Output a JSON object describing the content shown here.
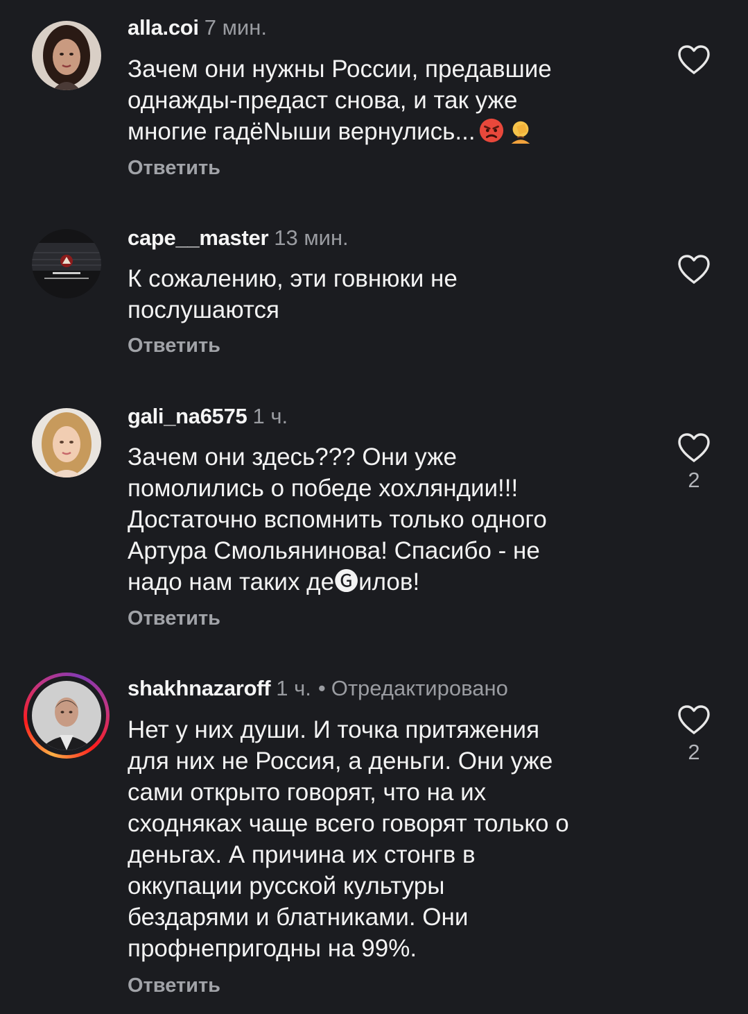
{
  "comments": [
    {
      "username": "alla.coi",
      "time": "7 мин.",
      "text": "Зачем они нужны России, предавшие\nоднажды-предаст снова, и так уже\nмногие гадёNыши вернулись...",
      "emojis": [
        "angry-face",
        "person-facepalming"
      ],
      "reply_label": "Ответить",
      "like_count": ""
    },
    {
      "username": "cape__master",
      "time": "13 мин.",
      "text": "К сожалению, эти говнюки не\nпослушаются",
      "reply_label": "Ответить",
      "like_count": ""
    },
    {
      "username": "gali_na6575",
      "time": "1 ч.",
      "text": "Зачем они здесь??? Они уже\nпомолились о победе хохляндии!!!\nДостаточно вспомнить только одного\nАртура Смольянинова! Спасибо - не\nнадо нам таких  де🅖илов!",
      "reply_label": "Ответить",
      "like_count": "2"
    },
    {
      "username": "shakhnazaroff",
      "time": "1 ч.",
      "dot": "•",
      "edited": "Отредактировано",
      "text": "Нет у них души. И точка притяжения\nдля них не Россия, а деньги. Они уже\nсами открыто говорят, что на их\nсходняках чаще всего говорят только о\nденьгах. А причина их стонгв в\nоккупации русской культуры\nбездарями и блатниками. Они\nпрофнепригодны на 99%.",
      "reply_label": "Ответить",
      "like_count": "2"
    }
  ],
  "colors": {
    "background": "#1b1c20",
    "text": "#f3f3f3",
    "secondary": "#9a9ca1",
    "heart_outline": "#e8e8e8"
  },
  "icons": [
    "heart-outline-icon",
    "angry-face-emoji",
    "facepalm-emoji"
  ]
}
